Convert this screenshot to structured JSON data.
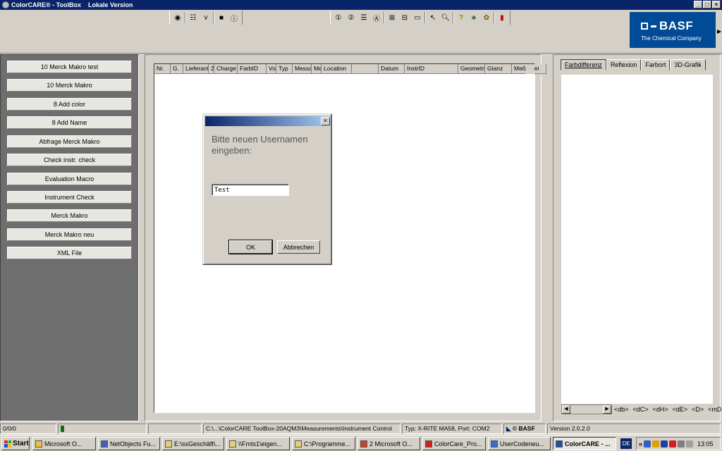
{
  "window": {
    "title": "ColorCARE® - ToolBox",
    "subtitle": "Lokale Version"
  },
  "toolbar": {
    "icons": [
      "palette-icon",
      "tree-icon",
      "filter-icon",
      "stop-icon",
      "info-icon",
      "view1-icon",
      "view2-icon",
      "split-icon",
      "letter-a-icon",
      "layout1-icon",
      "layout2-icon",
      "layout3-icon",
      "pointer-icon",
      "zoom-icon",
      "help-icon",
      "tool1-icon",
      "tool2-icon",
      "exit-icon"
    ]
  },
  "brand": {
    "name": "BASF",
    "tagline": "The Chemical Company",
    "color": "#004a96"
  },
  "macros": [
    "10 Merck Makro test",
    "10 Merck Makro",
    "8 Add color",
    "8 Add Name",
    "Abfrage Merck Makro",
    "Check instr. check",
    "Evaluation Macro",
    "Instrument Check",
    "Merck Makro",
    "Merck Makro neu",
    "XML File"
  ],
  "grid": {
    "columns": [
      "Nr.",
      "G.",
      "Lieferant",
      "2",
      "Charge",
      "FarbID",
      "Vo",
      "Typ",
      "Messa",
      "Me",
      "Location",
      "",
      "Datum",
      "InstrID",
      "Geometrie",
      "Glanz",
      "Meßdatei"
    ]
  },
  "dialog": {
    "prompt": "Bitte neuen Usernamen eingeben:",
    "input_value": "Test",
    "ok_label": "OK",
    "cancel_label": "Abbrechen"
  },
  "right_tabs": [
    "Farbdifferenz",
    "Reflexion",
    "Farbort",
    "3D-Grafik"
  ],
  "deltas": [
    "<db>",
    "<dC>",
    "<dH>",
    "<dE>",
    "<D>",
    "<mDE>"
  ],
  "status": {
    "counter": "0/0/0",
    "path": "C:\\...\\ColorCARE ToolBox-20AQM3\\Measurements\\Instrument Control",
    "instrument": "Typ: X-RITE MA58, Port: COM2",
    "copyright": "© BASF",
    "version": "Version 2.0.2.0"
  },
  "taskbar": {
    "start": "Start",
    "tasks": [
      "Microsoft O...",
      "NetObjects Fu...",
      "E:\\ssGeschäft\\...",
      "\\\\Fmts1\\eigen...",
      "C:\\Programme...",
      "2 Microsoft O...",
      "ColorCare_Pro...",
      "UserCodeneu...",
      "ColorCARE - ..."
    ],
    "language": "DE",
    "clock": "13:05"
  }
}
